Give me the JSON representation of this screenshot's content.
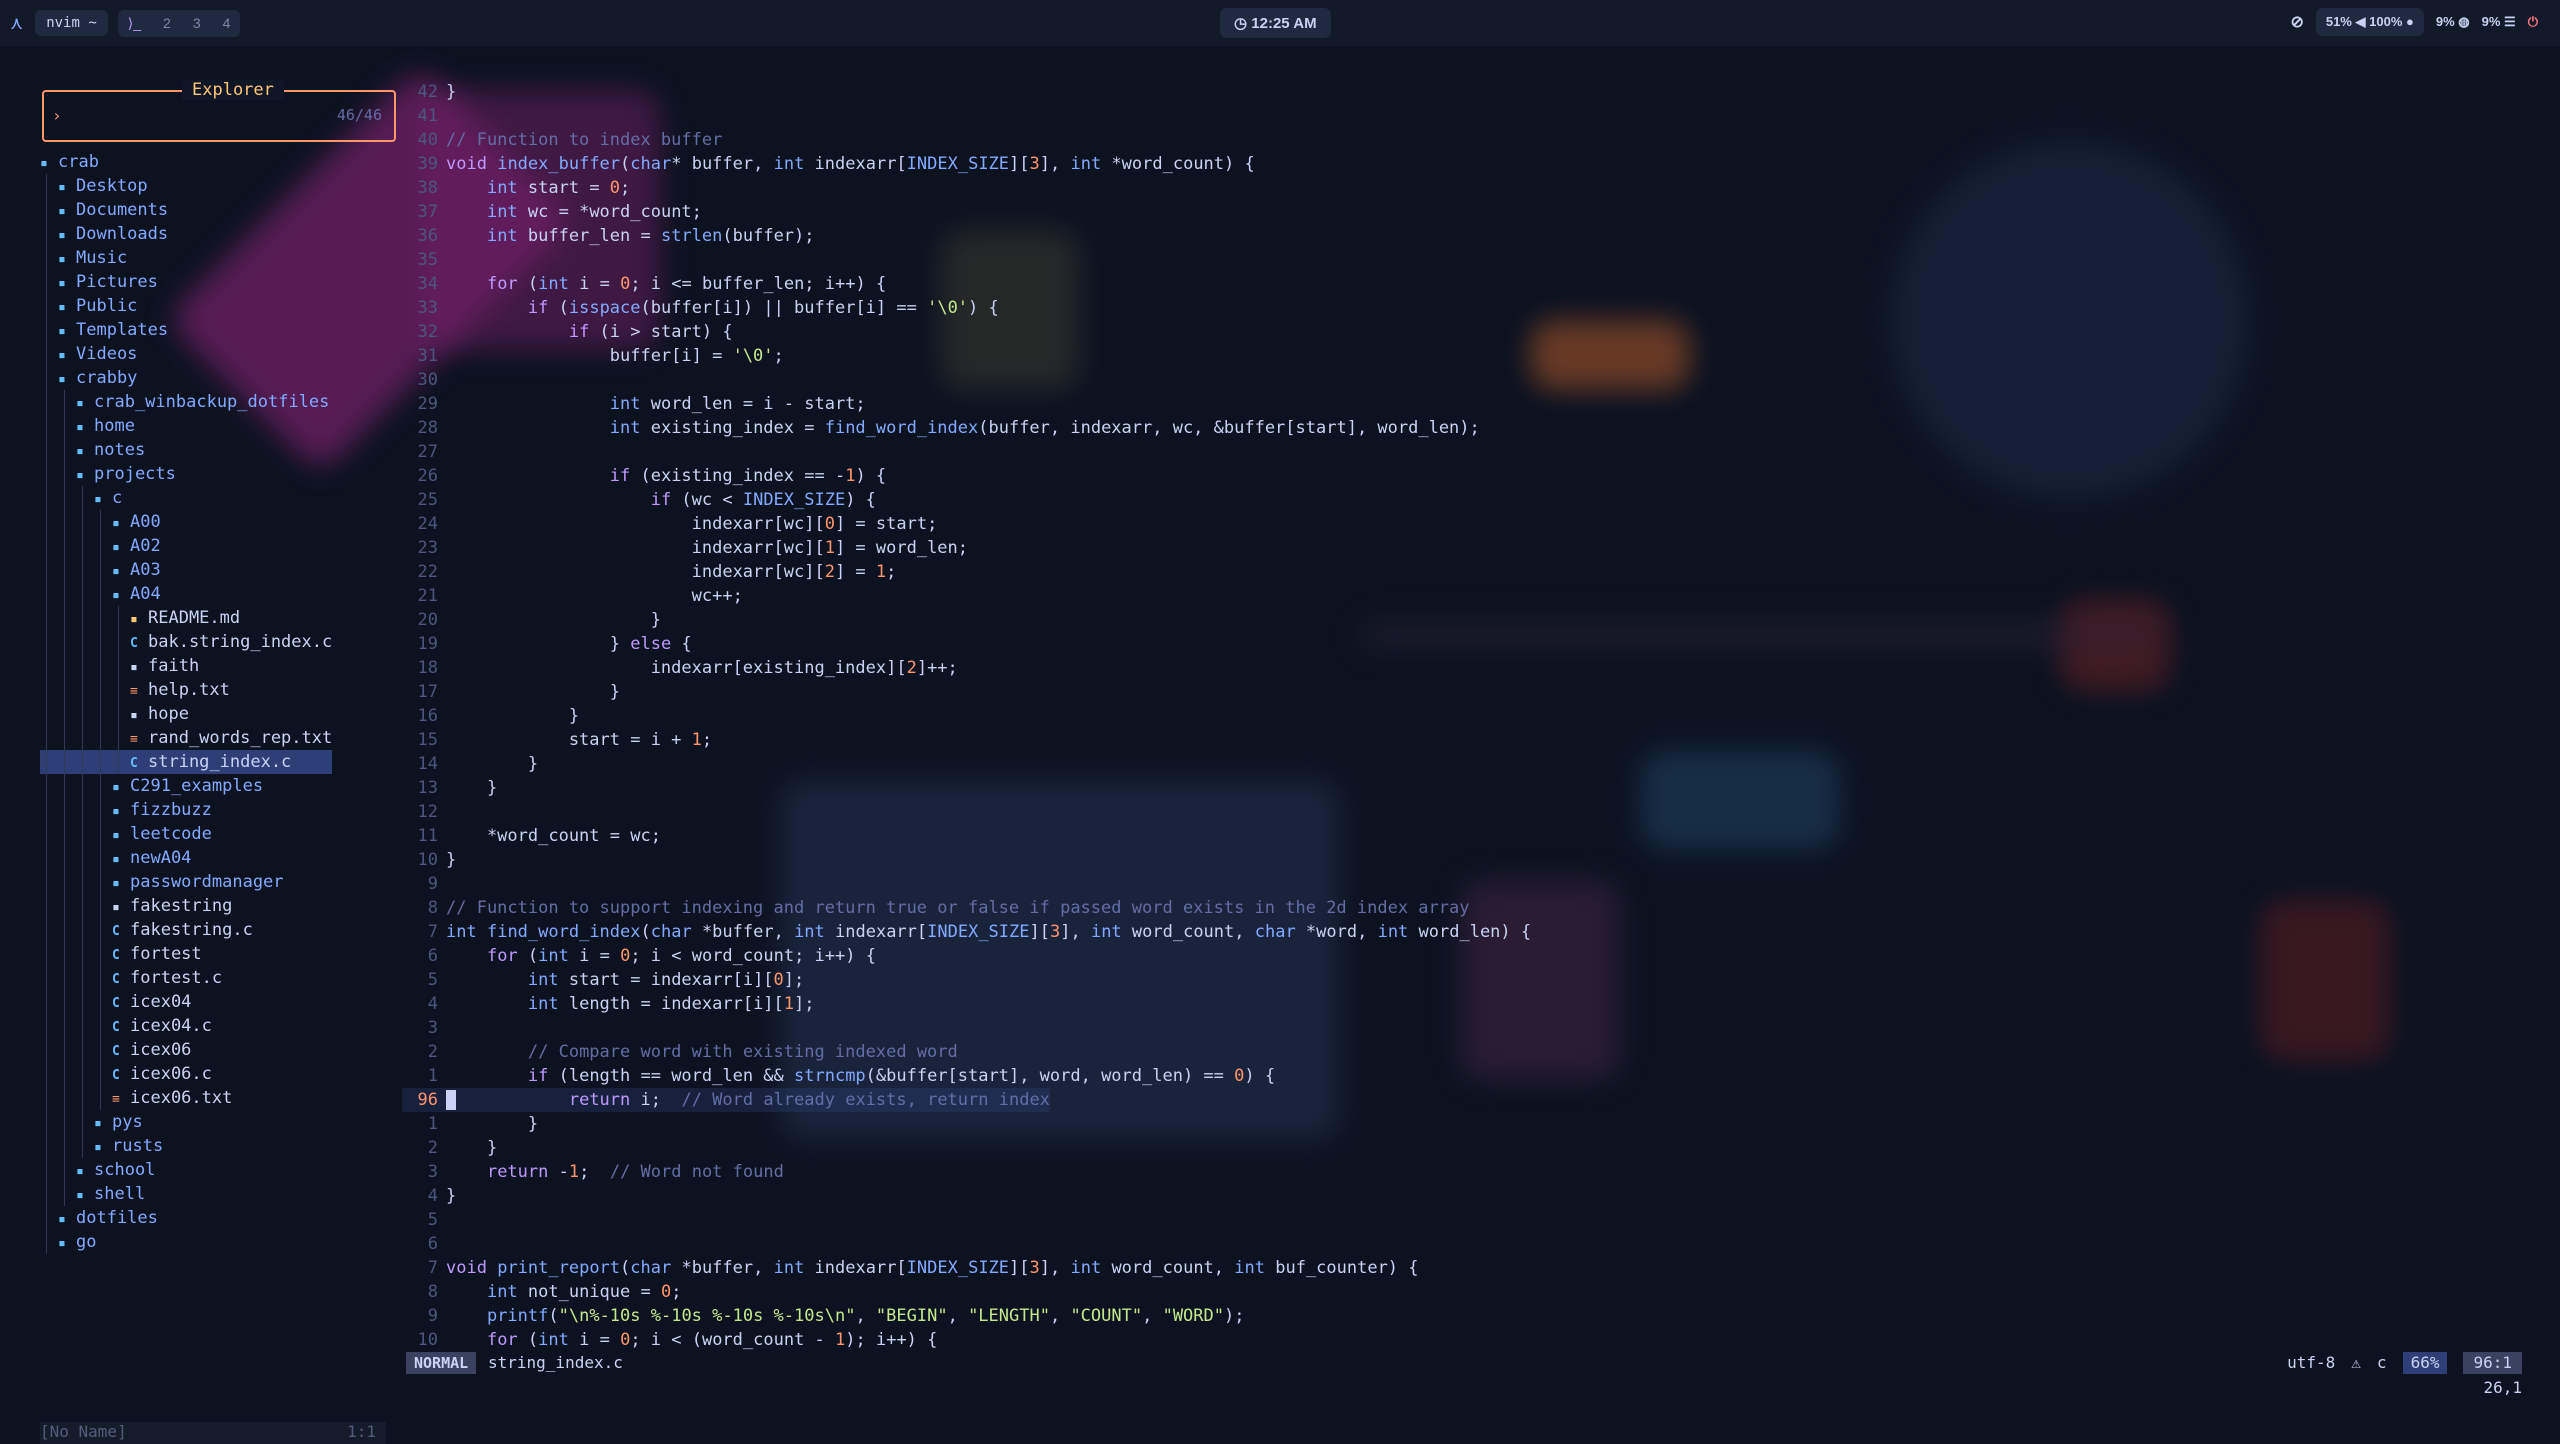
{
  "topbar": {
    "app_chip": "nvim ~",
    "workspaces": [
      "2",
      "3",
      "4"
    ],
    "clock": "12:25 AM",
    "brightness": "51%",
    "volume": "100%",
    "cpu": "9%",
    "mem": "9%"
  },
  "explorer": {
    "title": "Explorer",
    "prompt": "›",
    "count": "46/46",
    "status_left": "[No Name]",
    "status_right": "1:1",
    "items": [
      {
        "name": "crab",
        "kind": "dir",
        "depth": 0
      },
      {
        "name": "Desktop",
        "kind": "dir",
        "depth": 1
      },
      {
        "name": "Documents",
        "kind": "dir",
        "depth": 1
      },
      {
        "name": "Downloads",
        "kind": "dir",
        "depth": 1
      },
      {
        "name": "Music",
        "kind": "dir",
        "depth": 1
      },
      {
        "name": "Pictures",
        "kind": "dir",
        "depth": 1
      },
      {
        "name": "Public",
        "kind": "dir",
        "depth": 1
      },
      {
        "name": "Templates",
        "kind": "dir",
        "depth": 1
      },
      {
        "name": "Videos",
        "kind": "dir",
        "depth": 1
      },
      {
        "name": "crabby",
        "kind": "dir",
        "depth": 1
      },
      {
        "name": "crab_winbackup_dotfiles",
        "kind": "dir",
        "depth": 2
      },
      {
        "name": "home",
        "kind": "dir",
        "depth": 2
      },
      {
        "name": "notes",
        "kind": "dir",
        "depth": 2
      },
      {
        "name": "projects",
        "kind": "dir",
        "depth": 2
      },
      {
        "name": "c",
        "kind": "dir",
        "depth": 3
      },
      {
        "name": "A00",
        "kind": "dir",
        "depth": 4
      },
      {
        "name": "A02",
        "kind": "dir",
        "depth": 4
      },
      {
        "name": "A03",
        "kind": "dir",
        "depth": 4
      },
      {
        "name": "A04",
        "kind": "dir",
        "depth": 4
      },
      {
        "name": "README.md",
        "kind": "md",
        "depth": 5
      },
      {
        "name": "bak.string_index.c",
        "kind": "c",
        "depth": 5
      },
      {
        "name": "faith",
        "kind": "bin",
        "depth": 5
      },
      {
        "name": "help.txt",
        "kind": "txt",
        "depth": 5
      },
      {
        "name": "hope",
        "kind": "bin",
        "depth": 5
      },
      {
        "name": "rand_words_rep.txt",
        "kind": "txt",
        "depth": 5
      },
      {
        "name": "string_index.c",
        "kind": "c",
        "depth": 5,
        "selected": true
      },
      {
        "name": "C291_examples",
        "kind": "dir",
        "depth": 4
      },
      {
        "name": "fizzbuzz",
        "kind": "dir",
        "depth": 4
      },
      {
        "name": "leetcode",
        "kind": "dir",
        "depth": 4
      },
      {
        "name": "newA04",
        "kind": "dir",
        "depth": 4
      },
      {
        "name": "passwordmanager",
        "kind": "dir",
        "depth": 4
      },
      {
        "name": "fakestring",
        "kind": "bin",
        "depth": 4
      },
      {
        "name": "fakestring.c",
        "kind": "c",
        "depth": 4
      },
      {
        "name": "fortest",
        "kind": "c",
        "depth": 4
      },
      {
        "name": "fortest.c",
        "kind": "c",
        "depth": 4
      },
      {
        "name": "icex04",
        "kind": "c",
        "depth": 4
      },
      {
        "name": "icex04.c",
        "kind": "c",
        "depth": 4
      },
      {
        "name": "icex06",
        "kind": "c",
        "depth": 4
      },
      {
        "name": "icex06.c",
        "kind": "c",
        "depth": 4
      },
      {
        "name": "icex06.txt",
        "kind": "txt",
        "depth": 4
      },
      {
        "name": "pys",
        "kind": "dir",
        "depth": 3
      },
      {
        "name": "rusts",
        "kind": "dir",
        "depth": 3
      },
      {
        "name": "school",
        "kind": "dir",
        "depth": 2
      },
      {
        "name": "shell",
        "kind": "dir",
        "depth": 2
      },
      {
        "name": "dotfiles",
        "kind": "dir",
        "depth": 1
      },
      {
        "name": "go",
        "kind": "dir",
        "depth": 1
      }
    ]
  },
  "editor": {
    "lines": [
      {
        "n": "42",
        "t": "}"
      },
      {
        "n": "41",
        "t": ""
      },
      {
        "n": "40",
        "t": "// Function to index buffer"
      },
      {
        "n": "39",
        "t": "void index_buffer(char* buffer, int indexarr[INDEX_SIZE][3], int *word_count) {"
      },
      {
        "n": "38",
        "t": "    int start = 0;"
      },
      {
        "n": "37",
        "t": "    int wc = *word_count;"
      },
      {
        "n": "36",
        "t": "    int buffer_len = strlen(buffer);"
      },
      {
        "n": "35",
        "t": ""
      },
      {
        "n": "34",
        "t": "    for (int i = 0; i <= buffer_len; i++) {"
      },
      {
        "n": "33",
        "t": "        if (isspace(buffer[i]) || buffer[i] == '\\0') {"
      },
      {
        "n": "32",
        "t": "            if (i > start) {"
      },
      {
        "n": "31",
        "t": "                buffer[i] = '\\0';"
      },
      {
        "n": "30",
        "t": ""
      },
      {
        "n": "29",
        "t": "                int word_len = i - start;"
      },
      {
        "n": "28",
        "t": "                int existing_index = find_word_index(buffer, indexarr, wc, &buffer[start], word_len);"
      },
      {
        "n": "27",
        "t": ""
      },
      {
        "n": "26",
        "t": "                if (existing_index == -1) {"
      },
      {
        "n": "25",
        "t": "                    if (wc < INDEX_SIZE) {"
      },
      {
        "n": "24",
        "t": "                        indexarr[wc][0] = start;"
      },
      {
        "n": "23",
        "t": "                        indexarr[wc][1] = word_len;"
      },
      {
        "n": "22",
        "t": "                        indexarr[wc][2] = 1;"
      },
      {
        "n": "21",
        "t": "                        wc++;"
      },
      {
        "n": "20",
        "t": "                    }"
      },
      {
        "n": "19",
        "t": "                } else {"
      },
      {
        "n": "18",
        "t": "                    indexarr[existing_index][2]++;"
      },
      {
        "n": "17",
        "t": "                }"
      },
      {
        "n": "16",
        "t": "            }"
      },
      {
        "n": "15",
        "t": "            start = i + 1;"
      },
      {
        "n": "14",
        "t": "        }"
      },
      {
        "n": "13",
        "t": "    }"
      },
      {
        "n": "12",
        "t": ""
      },
      {
        "n": "11",
        "t": "    *word_count = wc;"
      },
      {
        "n": "10",
        "t": "}"
      },
      {
        "n": "9",
        "t": ""
      },
      {
        "n": "8",
        "t": "// Function to support indexing and return true or false if passed word exists in the 2d index array"
      },
      {
        "n": "7",
        "t": "int find_word_index(char *buffer, int indexarr[INDEX_SIZE][3], int word_count, char *word, int word_len) {"
      },
      {
        "n": "6",
        "t": "    for (int i = 0; i < word_count; i++) {"
      },
      {
        "n": "5",
        "t": "        int start = indexarr[i][0];"
      },
      {
        "n": "4",
        "t": "        int length = indexarr[i][1];"
      },
      {
        "n": "3",
        "t": ""
      },
      {
        "n": "2",
        "t": "        // Compare word with existing indexed word"
      },
      {
        "n": "1",
        "t": "        if (length == word_len && strncmp(&buffer[start], word, word_len) == 0) {"
      },
      {
        "n": "96",
        "t": "            return i;  // Word already exists, return index",
        "current": true
      },
      {
        "n": "1",
        "t": "        }"
      },
      {
        "n": "2",
        "t": "    }"
      },
      {
        "n": "3",
        "t": "    return -1;  // Word not found"
      },
      {
        "n": "4",
        "t": "}"
      },
      {
        "n": "5",
        "t": ""
      },
      {
        "n": "6",
        "t": ""
      },
      {
        "n": "7",
        "t": "void print_report(char *buffer, int indexarr[INDEX_SIZE][3], int word_count, int buf_counter) {"
      },
      {
        "n": "8",
        "t": "    int not_unique = 0;"
      },
      {
        "n": "9",
        "t": "    printf(\"\\n%-10s %-10s %-10s %-10s\\n\", \"BEGIN\", \"LENGTH\", \"COUNT\", \"WORD\");"
      },
      {
        "n": "10",
        "t": "    for (int i = 0; i < (word_count - 1); i++) {"
      }
    ]
  },
  "statusline": {
    "mode": "NORMAL",
    "filename": "string_index.c",
    "encoding": "utf-8",
    "filetype": "c",
    "percent": "66%",
    "position": "96:1",
    "cmdline_pos": "26,1"
  }
}
